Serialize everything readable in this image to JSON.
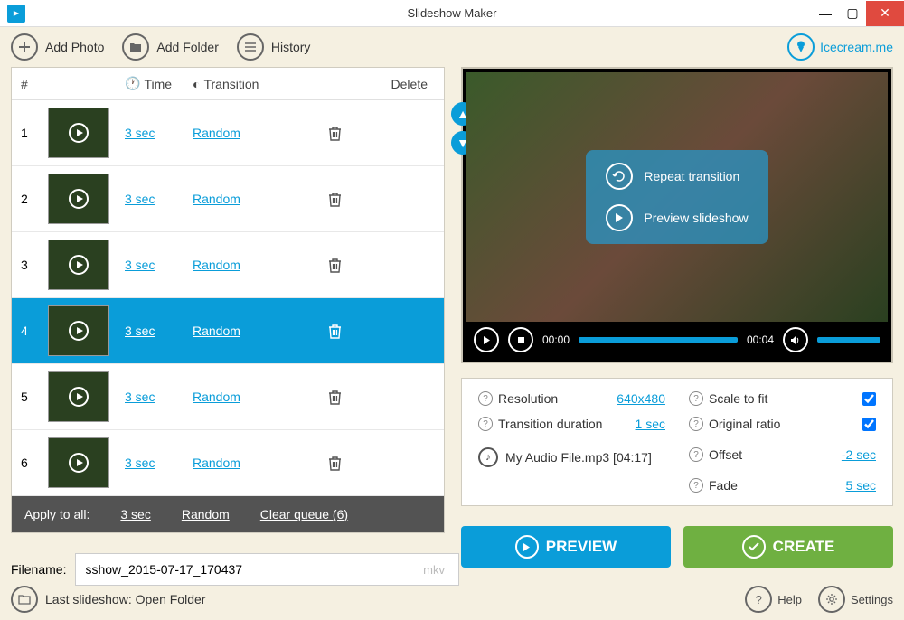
{
  "window": {
    "title": "Slideshow Maker"
  },
  "toolbar": {
    "add_photo": "Add Photo",
    "add_folder": "Add Folder",
    "history": "History",
    "brand": "Icecream.me"
  },
  "table": {
    "headers": {
      "num": "#",
      "time": "Time",
      "transition": "Transition",
      "delete": "Delete"
    },
    "rows": [
      {
        "n": "1",
        "time": "3 sec",
        "transition": "Random",
        "selected": false
      },
      {
        "n": "2",
        "time": "3 sec",
        "transition": "Random",
        "selected": false
      },
      {
        "n": "3",
        "time": "3 sec",
        "transition": "Random",
        "selected": false
      },
      {
        "n": "4",
        "time": "3 sec",
        "transition": "Random",
        "selected": true
      },
      {
        "n": "5",
        "time": "3 sec",
        "transition": "Random",
        "selected": false
      },
      {
        "n": "6",
        "time": "3 sec",
        "transition": "Random",
        "selected": false
      }
    ],
    "apply_all": {
      "label": "Apply to all:",
      "time": "3 sec",
      "transition": "Random",
      "clear": "Clear queue (6)"
    }
  },
  "filename": {
    "label": "Filename:",
    "value": "sshow_2015-07-17_170437",
    "ext": "mkv"
  },
  "preview": {
    "repeat": "Repeat transition",
    "slideshow": "Preview slideshow",
    "time_start": "00:00",
    "time_end": "00:04"
  },
  "settings": {
    "resolution": {
      "label": "Resolution",
      "value": "640x480"
    },
    "scale": {
      "label": "Scale to fit",
      "checked": true
    },
    "transition_dur": {
      "label": "Transition duration",
      "value": "1 sec"
    },
    "original_ratio": {
      "label": "Original ratio",
      "checked": true
    },
    "offset": {
      "label": "Offset",
      "value": "-2 sec"
    },
    "fade": {
      "label": "Fade",
      "value": "5 sec"
    },
    "audio": "My Audio File.mp3 [04:17]"
  },
  "actions": {
    "preview": "PREVIEW",
    "create": "CREATE"
  },
  "footer": {
    "last": "Last slideshow: Open Folder",
    "help": "Help",
    "settings": "Settings"
  }
}
